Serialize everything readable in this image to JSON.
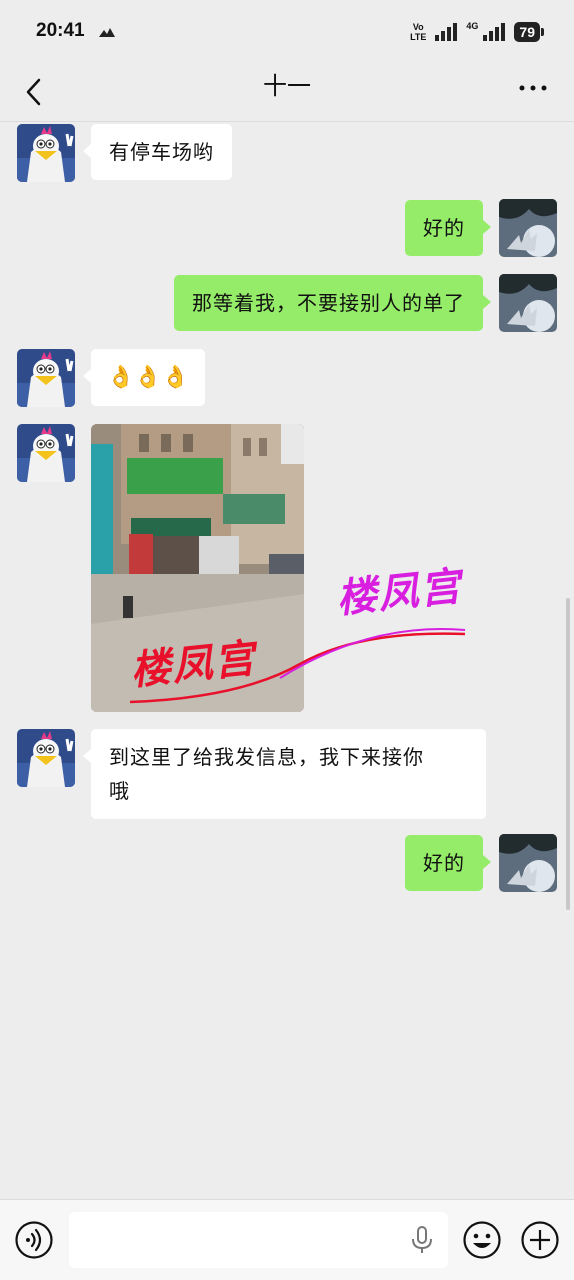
{
  "status_bar": {
    "time": "20:41",
    "volte_top": "Vo",
    "volte_bottom": "LTE",
    "network": "4G",
    "battery": "79"
  },
  "nav": {
    "title": "十一",
    "back_icon": "chevron-left-icon",
    "more_icon": "ellipsis-icon"
  },
  "messages": [
    {
      "side": "in",
      "type": "text",
      "text": "有停车场哟"
    },
    {
      "side": "out",
      "type": "text",
      "text": "好的"
    },
    {
      "side": "out",
      "type": "text",
      "text": "那等着我，不要接别人的单了"
    },
    {
      "side": "in",
      "type": "emoji",
      "text": "👌👌👌"
    },
    {
      "side": "in",
      "type": "image",
      "watermark": "楼凤宫"
    },
    {
      "side": "in",
      "type": "text",
      "text_line1": "到这里了给我发信息，我下来接你",
      "text_line2": "哦"
    },
    {
      "side": "out",
      "type": "text",
      "text": "好的"
    }
  ],
  "input_bar": {
    "voice_icon": "voice-icon",
    "mic_icon": "mic-icon",
    "emoji_icon": "emoji-icon",
    "plus_icon": "plus-icon"
  },
  "colors": {
    "background": "#ededed",
    "bubble_out": "#95ec69",
    "bubble_in": "#ffffff",
    "watermark_red": "#e8102a",
    "watermark_purple": "#d81fe0"
  }
}
